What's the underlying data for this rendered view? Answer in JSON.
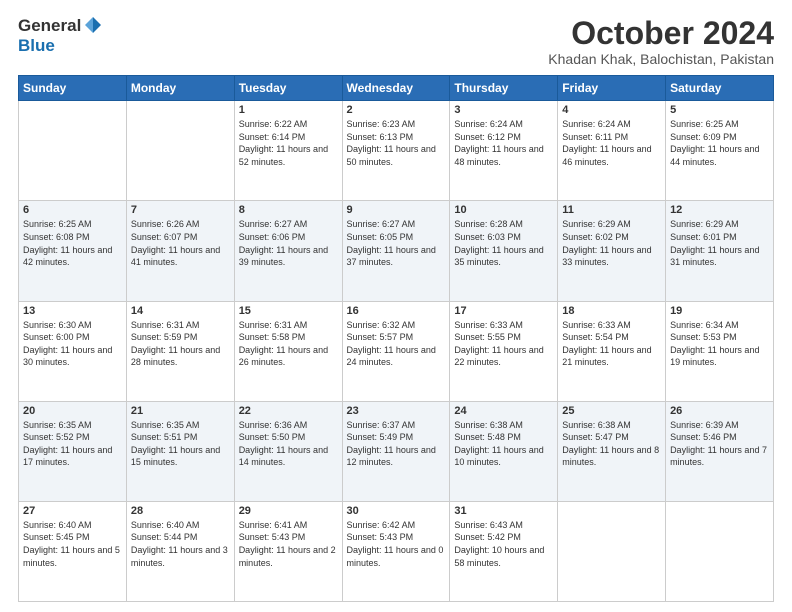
{
  "logo": {
    "general": "General",
    "blue": "Blue"
  },
  "title": "October 2024",
  "subtitle": "Khadan Khak, Balochistan, Pakistan",
  "days_of_week": [
    "Sunday",
    "Monday",
    "Tuesday",
    "Wednesday",
    "Thursday",
    "Friday",
    "Saturday"
  ],
  "weeks": [
    [
      {
        "day": "",
        "content": ""
      },
      {
        "day": "",
        "content": ""
      },
      {
        "day": "1",
        "content": "Sunrise: 6:22 AM\nSunset: 6:14 PM\nDaylight: 11 hours and 52 minutes."
      },
      {
        "day": "2",
        "content": "Sunrise: 6:23 AM\nSunset: 6:13 PM\nDaylight: 11 hours and 50 minutes."
      },
      {
        "day": "3",
        "content": "Sunrise: 6:24 AM\nSunset: 6:12 PM\nDaylight: 11 hours and 48 minutes."
      },
      {
        "day": "4",
        "content": "Sunrise: 6:24 AM\nSunset: 6:11 PM\nDaylight: 11 hours and 46 minutes."
      },
      {
        "day": "5",
        "content": "Sunrise: 6:25 AM\nSunset: 6:09 PM\nDaylight: 11 hours and 44 minutes."
      }
    ],
    [
      {
        "day": "6",
        "content": "Sunrise: 6:25 AM\nSunset: 6:08 PM\nDaylight: 11 hours and 42 minutes."
      },
      {
        "day": "7",
        "content": "Sunrise: 6:26 AM\nSunset: 6:07 PM\nDaylight: 11 hours and 41 minutes."
      },
      {
        "day": "8",
        "content": "Sunrise: 6:27 AM\nSunset: 6:06 PM\nDaylight: 11 hours and 39 minutes."
      },
      {
        "day": "9",
        "content": "Sunrise: 6:27 AM\nSunset: 6:05 PM\nDaylight: 11 hours and 37 minutes."
      },
      {
        "day": "10",
        "content": "Sunrise: 6:28 AM\nSunset: 6:03 PM\nDaylight: 11 hours and 35 minutes."
      },
      {
        "day": "11",
        "content": "Sunrise: 6:29 AM\nSunset: 6:02 PM\nDaylight: 11 hours and 33 minutes."
      },
      {
        "day": "12",
        "content": "Sunrise: 6:29 AM\nSunset: 6:01 PM\nDaylight: 11 hours and 31 minutes."
      }
    ],
    [
      {
        "day": "13",
        "content": "Sunrise: 6:30 AM\nSunset: 6:00 PM\nDaylight: 11 hours and 30 minutes."
      },
      {
        "day": "14",
        "content": "Sunrise: 6:31 AM\nSunset: 5:59 PM\nDaylight: 11 hours and 28 minutes."
      },
      {
        "day": "15",
        "content": "Sunrise: 6:31 AM\nSunset: 5:58 PM\nDaylight: 11 hours and 26 minutes."
      },
      {
        "day": "16",
        "content": "Sunrise: 6:32 AM\nSunset: 5:57 PM\nDaylight: 11 hours and 24 minutes."
      },
      {
        "day": "17",
        "content": "Sunrise: 6:33 AM\nSunset: 5:55 PM\nDaylight: 11 hours and 22 minutes."
      },
      {
        "day": "18",
        "content": "Sunrise: 6:33 AM\nSunset: 5:54 PM\nDaylight: 11 hours and 21 minutes."
      },
      {
        "day": "19",
        "content": "Sunrise: 6:34 AM\nSunset: 5:53 PM\nDaylight: 11 hours and 19 minutes."
      }
    ],
    [
      {
        "day": "20",
        "content": "Sunrise: 6:35 AM\nSunset: 5:52 PM\nDaylight: 11 hours and 17 minutes."
      },
      {
        "day": "21",
        "content": "Sunrise: 6:35 AM\nSunset: 5:51 PM\nDaylight: 11 hours and 15 minutes."
      },
      {
        "day": "22",
        "content": "Sunrise: 6:36 AM\nSunset: 5:50 PM\nDaylight: 11 hours and 14 minutes."
      },
      {
        "day": "23",
        "content": "Sunrise: 6:37 AM\nSunset: 5:49 PM\nDaylight: 11 hours and 12 minutes."
      },
      {
        "day": "24",
        "content": "Sunrise: 6:38 AM\nSunset: 5:48 PM\nDaylight: 11 hours and 10 minutes."
      },
      {
        "day": "25",
        "content": "Sunrise: 6:38 AM\nSunset: 5:47 PM\nDaylight: 11 hours and 8 minutes."
      },
      {
        "day": "26",
        "content": "Sunrise: 6:39 AM\nSunset: 5:46 PM\nDaylight: 11 hours and 7 minutes."
      }
    ],
    [
      {
        "day": "27",
        "content": "Sunrise: 6:40 AM\nSunset: 5:45 PM\nDaylight: 11 hours and 5 minutes."
      },
      {
        "day": "28",
        "content": "Sunrise: 6:40 AM\nSunset: 5:44 PM\nDaylight: 11 hours and 3 minutes."
      },
      {
        "day": "29",
        "content": "Sunrise: 6:41 AM\nSunset: 5:43 PM\nDaylight: 11 hours and 2 minutes."
      },
      {
        "day": "30",
        "content": "Sunrise: 6:42 AM\nSunset: 5:43 PM\nDaylight: 11 hours and 0 minutes."
      },
      {
        "day": "31",
        "content": "Sunrise: 6:43 AM\nSunset: 5:42 PM\nDaylight: 10 hours and 58 minutes."
      },
      {
        "day": "",
        "content": ""
      },
      {
        "day": "",
        "content": ""
      }
    ]
  ]
}
